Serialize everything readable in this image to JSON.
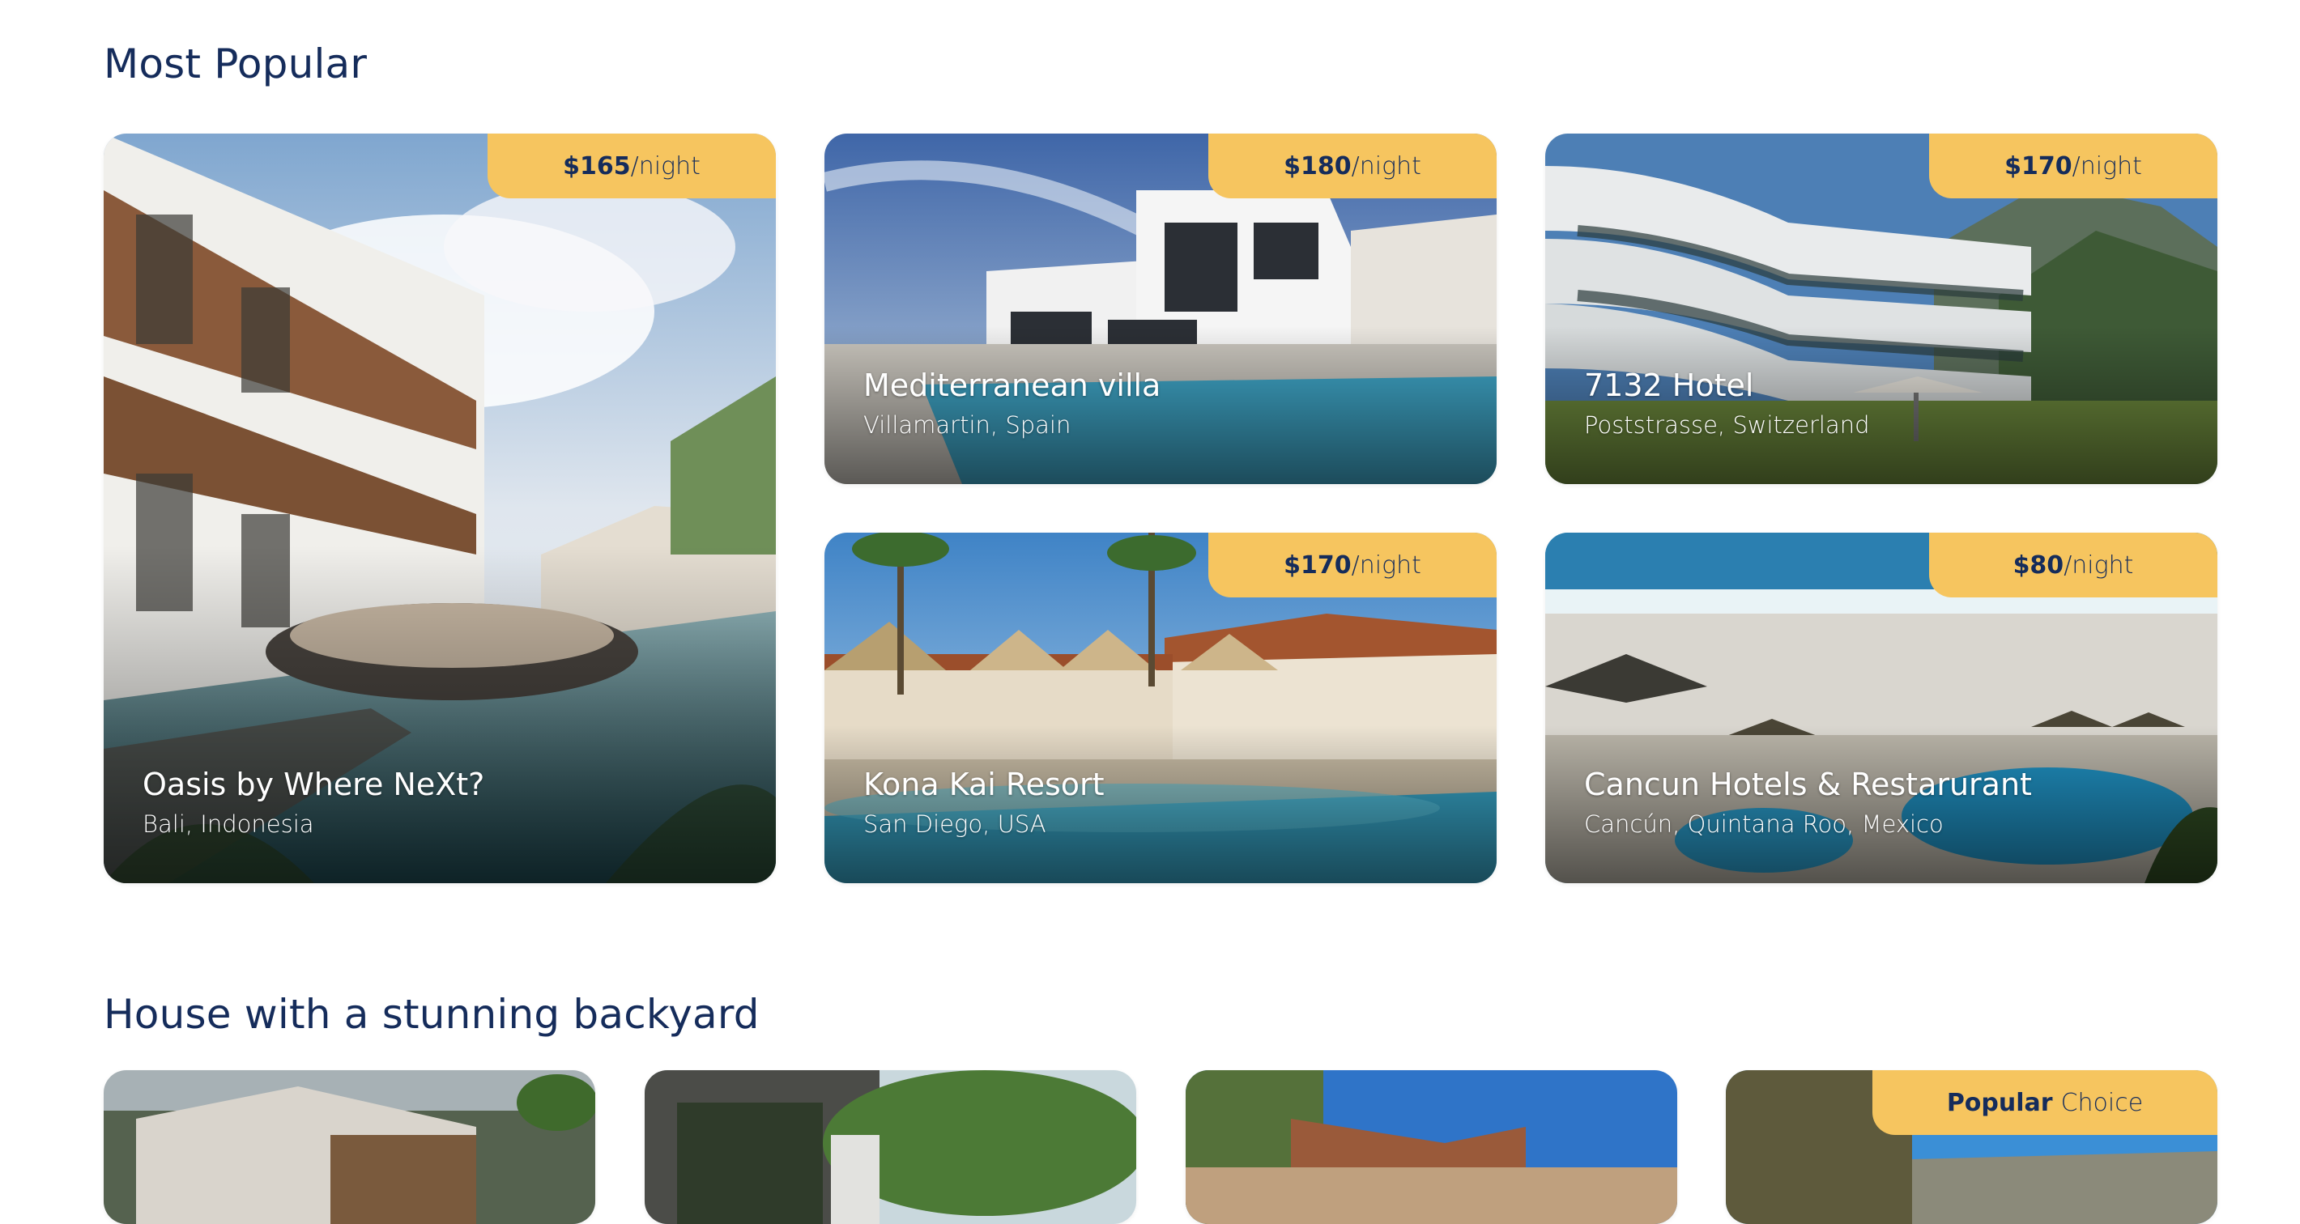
{
  "most_popular": {
    "title": "Most Popular",
    "price_unit": "/night",
    "cards": [
      {
        "name": "Oasis by Where NeXt?",
        "location": "Bali, Indonesia",
        "price": "$165"
      },
      {
        "name": "Mediterranean villa",
        "location": "Villamartin, Spain",
        "price": "$180"
      },
      {
        "name": "7132 Hotel",
        "location": "Poststrasse, Switzerland",
        "price": "$170"
      },
      {
        "name": "Kona Kai Resort",
        "location": "San Diego, USA",
        "price": "$170"
      },
      {
        "name": "Cancun Hotels & Restarurant",
        "location": "Cancún, Quintana Roo, Mexico",
        "price": "$80"
      }
    ]
  },
  "backyard": {
    "title": "House with a stunning backyard",
    "badge_bold": "Popular",
    "badge_rest": "Choice"
  },
  "colors": {
    "accent": "#f6c55f",
    "heading": "#152c5b"
  }
}
